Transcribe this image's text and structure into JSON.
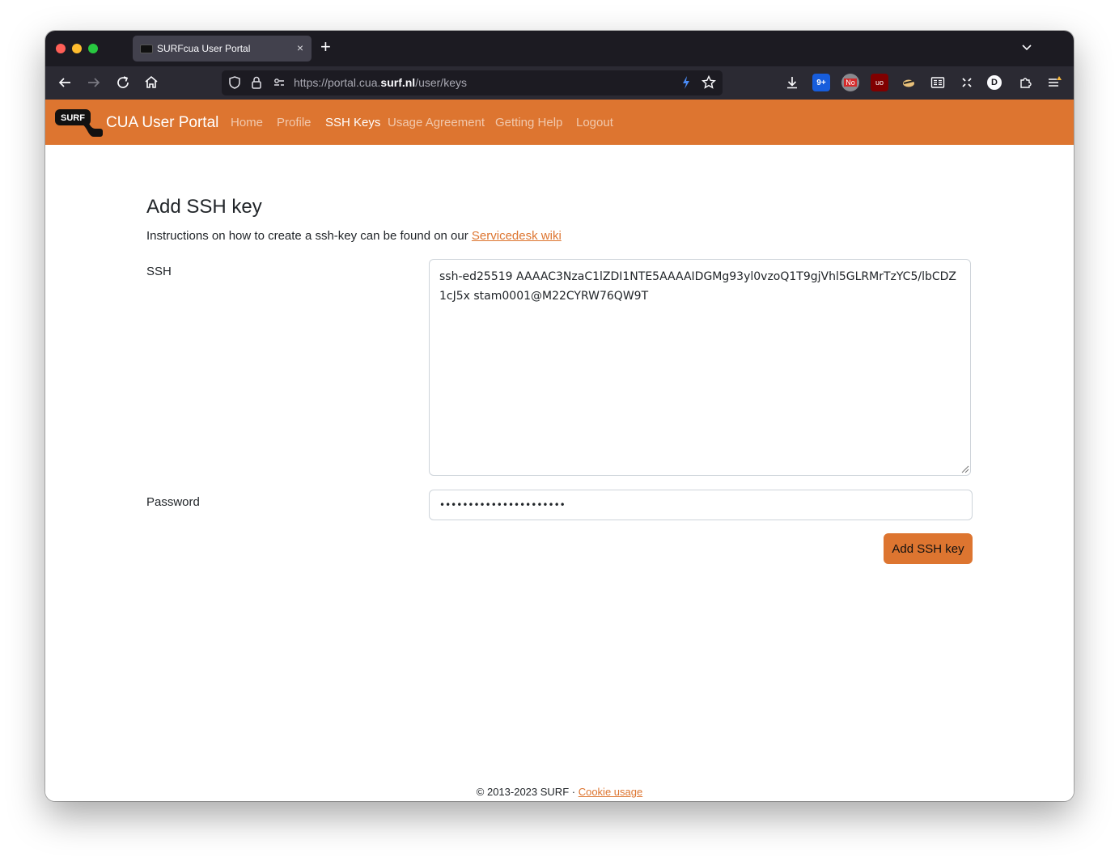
{
  "browser": {
    "tab_title": "SURFcua User Portal",
    "tab_close": "×",
    "new_tab": "+",
    "url_prefix": "https://portal.cua.",
    "url_domain": "surf.nl",
    "url_path": "/user/keys",
    "extensions": {
      "bitwarden_badge": "9+",
      "noscript_badge": "No",
      "ublock_label": "uo",
      "account_initial": "D"
    }
  },
  "site": {
    "logo_text": "SURF",
    "brand": "CUA User Portal",
    "nav": [
      {
        "label": "Home"
      },
      {
        "label": "Profile"
      },
      {
        "label": "SSH Keys",
        "active": true
      },
      {
        "label": "Usage Agreement"
      },
      {
        "label": "Getting Help"
      },
      {
        "label": "Logout"
      }
    ]
  },
  "form": {
    "heading": "Add SSH key",
    "instructions_text": "Instructions on how to create a ssh-key can be found on our ",
    "instructions_link": "Servicedesk wiki",
    "ssh_label": "SSH",
    "ssh_value": "ssh-ed25519 AAAAC3NzaC1lZDI1NTE5AAAAIDGMg93yl0vzoQ1T9gjVhl5GLRMrTzYC5/lbCDZ1cJ5x stam0001@M22CYRW76QW9T",
    "password_label": "Password",
    "password_value": "••••••••••••••••••••••",
    "submit_label": "Add SSH key"
  },
  "footer": {
    "text": "© 2013-2023 SURF · ",
    "link": "Cookie usage"
  },
  "colors": {
    "brand_orange": "#dd7530",
    "browser_dark": "#1c1b22",
    "toolbar_dark": "#2b2a33"
  }
}
